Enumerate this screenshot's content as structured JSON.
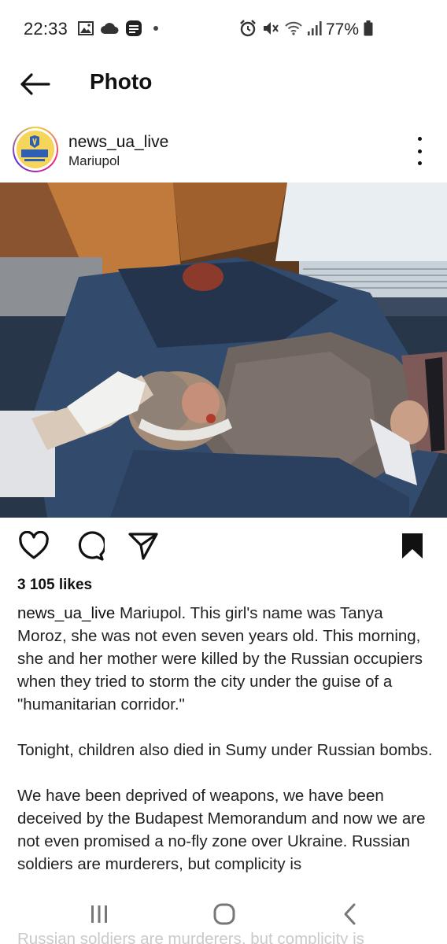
{
  "status_bar": {
    "time": "22:33",
    "battery": "77%",
    "icons": [
      "gallery-icon",
      "cloud-icon",
      "app-badge-icon",
      "dot-icon",
      "alarm-icon",
      "mute-icon",
      "wifi-icon",
      "signal-icon",
      "battery-icon"
    ]
  },
  "header": {
    "back_icon": "arrow-left-icon",
    "title": "Photo"
  },
  "post": {
    "username": "news_ua_live",
    "location": "Mariupol",
    "more_icon": "vertical-dots-icon",
    "likes": "3 105 likes",
    "caption_user": "news_ua_live",
    "caption_paragraphs": [
      "Mariupol. This girl's name was Tanya Moroz, she was not even seven years old. This morning, she and her mother were killed by the Russian occupiers when they tried to storm the city under the guise of a \"humanitarian corridor.\"",
      "Tonight, children also died in Sumy under Russian bombs.",
      "We have been deprived of weapons, we have been deceived by the Budapest Memorandum and now we are not even promised a no-fly zone over Ukraine. Russian soldiers are murderers, but complicity is"
    ],
    "actions": [
      "heart-icon",
      "comment-icon",
      "share-icon",
      "bookmark-icon"
    ]
  },
  "nav_bar": {
    "ghost_text": "Russian soldiers are murderers, but complicity is",
    "buttons": [
      "recents-icon",
      "home-icon",
      "back-icon"
    ]
  },
  "colors": {
    "text": "#111111",
    "nav_icon": "#777777",
    "background": "#ffffff"
  }
}
